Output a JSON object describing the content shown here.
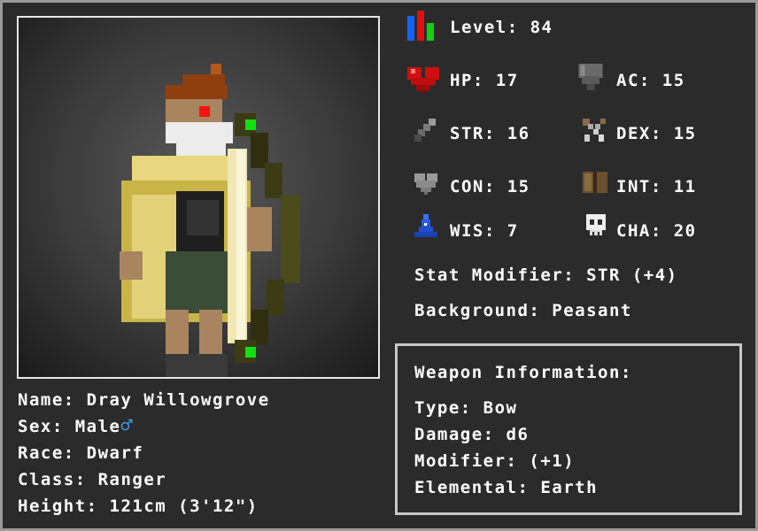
{
  "character": {
    "name_line": "Name: Dray Willowgrove",
    "sex_line": "Sex: Male",
    "sex_symbol": "♂",
    "race_line": "Race: Dwarf",
    "class_line": "Class: Ranger",
    "height_line": "Height: 121cm (3'12\")"
  },
  "stats": {
    "level": "Level: 84",
    "hp": "HP: 17",
    "ac": "AC: 15",
    "str": "STR: 16",
    "dex": "DEX: 15",
    "con": "CON: 15",
    "int": "INT: 11",
    "wis": "WIS: 7",
    "cha": "CHA: 20",
    "modifier": "Stat Modifier: STR (+4)",
    "background": "Background: Peasant"
  },
  "weapon": {
    "header": "Weapon Information:",
    "type": "Type: Bow",
    "damage": "Damage: d6",
    "modifier": "Modifier: (+1)",
    "elemental": "Elemental: Earth"
  },
  "icons": {
    "level": "level-bars-icon",
    "hp": "heart-icon",
    "ac": "shield-icon",
    "str": "sword-icon",
    "dex": "crossed-daggers-icon",
    "con": "grey-heart-icon",
    "int": "book-icon",
    "wis": "wizard-hat-icon",
    "cha": "skull-icon"
  },
  "colors": {
    "background": "#2b2b2b",
    "frame": "#9a9a9a",
    "text": "#ffffff",
    "male_symbol": "#3aa0e8"
  }
}
